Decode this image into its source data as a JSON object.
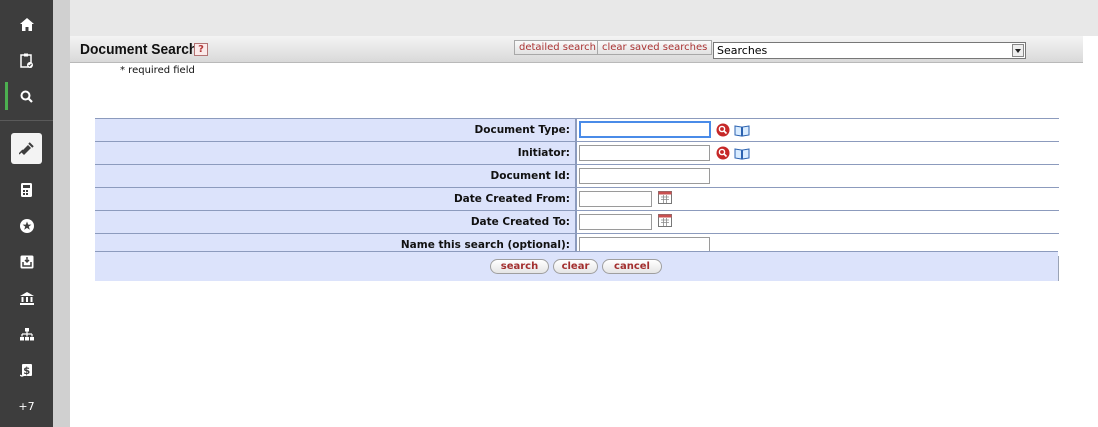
{
  "sidebar": {
    "items": [
      {
        "icon": "home-icon"
      },
      {
        "icon": "clipboard-check-icon"
      },
      {
        "icon": "search-icon"
      },
      {
        "icon": "pin-icon"
      },
      {
        "icon": "calculator-icon"
      },
      {
        "icon": "star-icon"
      },
      {
        "icon": "inbox-icon"
      },
      {
        "icon": "bank-icon"
      },
      {
        "icon": "org-chart-icon"
      },
      {
        "icon": "dollar-scroll-icon"
      }
    ],
    "more_label": "+7"
  },
  "header": {
    "title": "Document Search",
    "help_label": "?",
    "detailed_search_label": "detailed search",
    "clear_saved_label": "clear saved searches",
    "saved_searches_value": "Searches"
  },
  "required_note": "* required field",
  "form": {
    "fields": [
      {
        "label": "Document Type:",
        "value": "",
        "lookup": true,
        "focused": true
      },
      {
        "label": "Initiator:",
        "value": "",
        "lookup": true
      },
      {
        "label": "Document Id:",
        "value": ""
      },
      {
        "label": "Date Created From:",
        "value": "",
        "calendar": true
      },
      {
        "label": "Date Created To:",
        "value": "",
        "calendar": true
      },
      {
        "label": "Name this search (optional):",
        "value": ""
      }
    ],
    "buttons": {
      "search": "search",
      "clear": "clear",
      "cancel": "cancel"
    }
  },
  "colors": {
    "sidebar_bg": "#3d3d3d",
    "form_label_bg": "#dce3fb",
    "button_text": "#a32f2f",
    "active_indicator": "#4caf50"
  }
}
